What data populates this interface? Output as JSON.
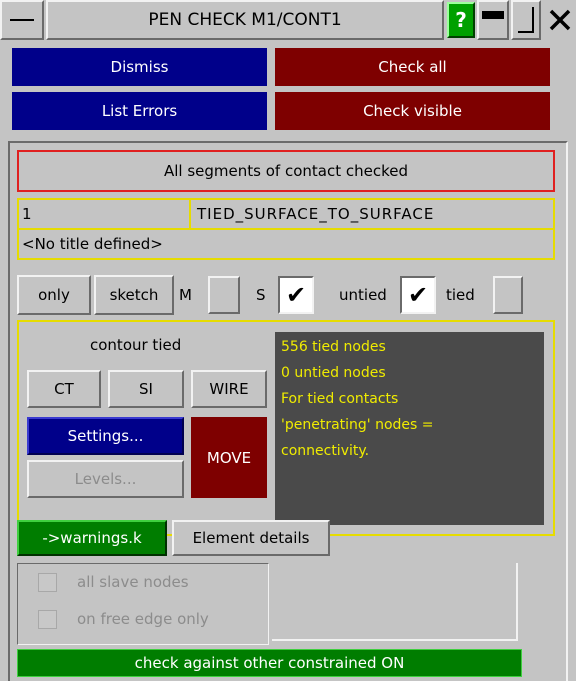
{
  "window": {
    "title": "PEN CHECK M1/CONT1",
    "help_label": "?",
    "minimize_label": "▬",
    "restore_label": "▭",
    "close_label": "✕"
  },
  "toolbar": {
    "dismiss": "Dismiss",
    "check_all": "Check all",
    "list_errors": "List Errors",
    "check_visible": "Check visible"
  },
  "status_message": "All segments of contact checked",
  "contact": {
    "id": "1",
    "type": "TIED_SURFACE_TO_SURFACE",
    "title": "<No title defined>"
  },
  "filters": {
    "only": "only",
    "sketch": "sketch",
    "m_label": "M",
    "m_checked": false,
    "s_label": "S",
    "s_checked": true,
    "untied_label": "untied",
    "untied_checked": true,
    "tied_label": "tied",
    "tied_checked": false
  },
  "contour": {
    "title": "contour tied",
    "ct": "CT",
    "si": "SI",
    "wire": "WIRE",
    "settings": "Settings...",
    "levels": "Levels...",
    "move": "MOVE",
    "info_lines": [
      "556 tied nodes",
      "0 untied nodes",
      "For tied contacts",
      "'penetrating' nodes =",
      "connectivity."
    ]
  },
  "bottom": {
    "warnings": "->warnings.k",
    "element_details": "Element details",
    "all_slave_nodes": "all slave nodes",
    "free_edge_only": "on free edge only",
    "constrained": "check against other constrained ON"
  },
  "colors": {
    "background": "#c4c4c4",
    "blue_button": "#00008a",
    "red_button": "#7e0000",
    "green_button": "#007d00",
    "yellow_border": "#e6dc00",
    "red_border": "#e02020",
    "info_panel": "#4a4a4a",
    "info_text": "#f0ec00"
  }
}
